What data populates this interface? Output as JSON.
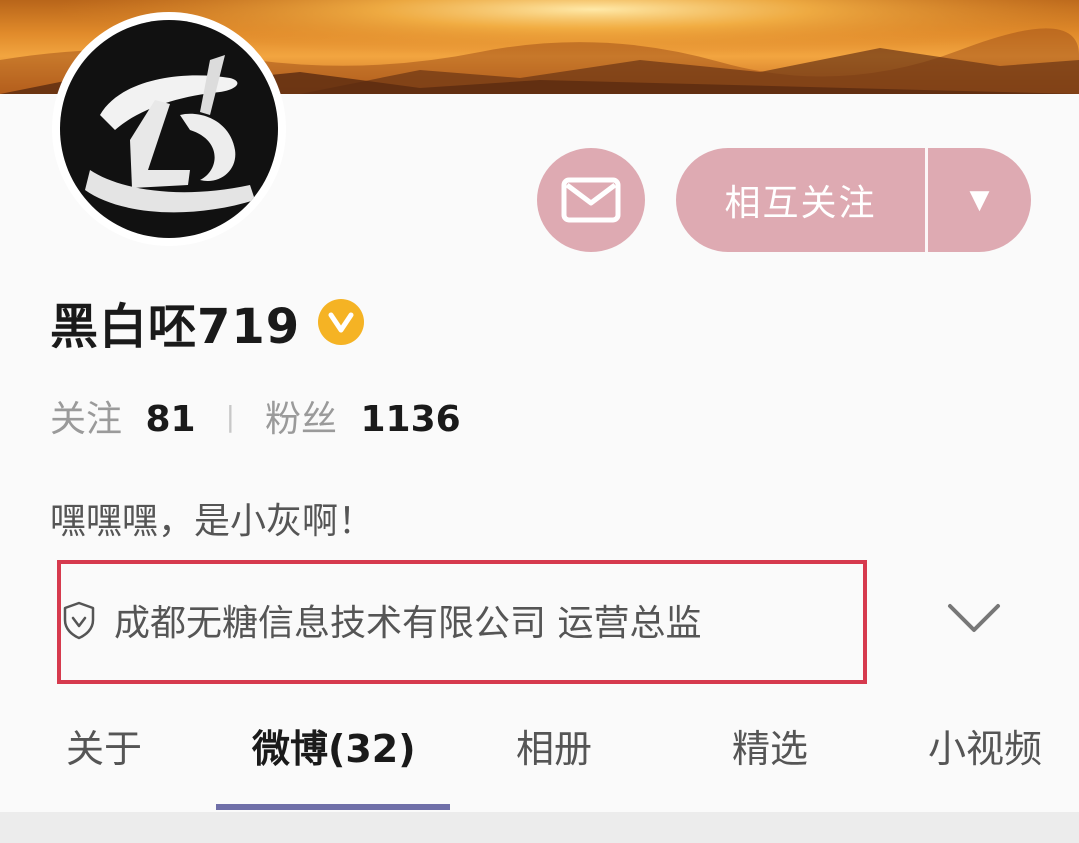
{
  "profile": {
    "username": "黑白呸719",
    "verified_badge_icon": "verified-v-badge",
    "bio": "嘿嘿嘿，是小灰啊！",
    "company": "成都无糖信息技术有限公司 运营总监"
  },
  "actions": {
    "message_icon": "envelope-icon",
    "follow_label": "相互关注",
    "dropdown_icon": "▼"
  },
  "stats": {
    "following_label": "关注",
    "following_count": "81",
    "separator": "|",
    "followers_label": "粉丝",
    "followers_count": "1136"
  },
  "tabs": [
    {
      "label": "关于"
    },
    {
      "label": "微博(32)"
    },
    {
      "label": "相册"
    },
    {
      "label": "精选"
    },
    {
      "label": "小视频"
    }
  ],
  "active_tab": "微博(32)",
  "colors": {
    "accent_button": "#deaab2",
    "verified_badge": "#f5b324",
    "highlight_border": "#d63a4e",
    "tab_underline": "#6f6fa8"
  }
}
